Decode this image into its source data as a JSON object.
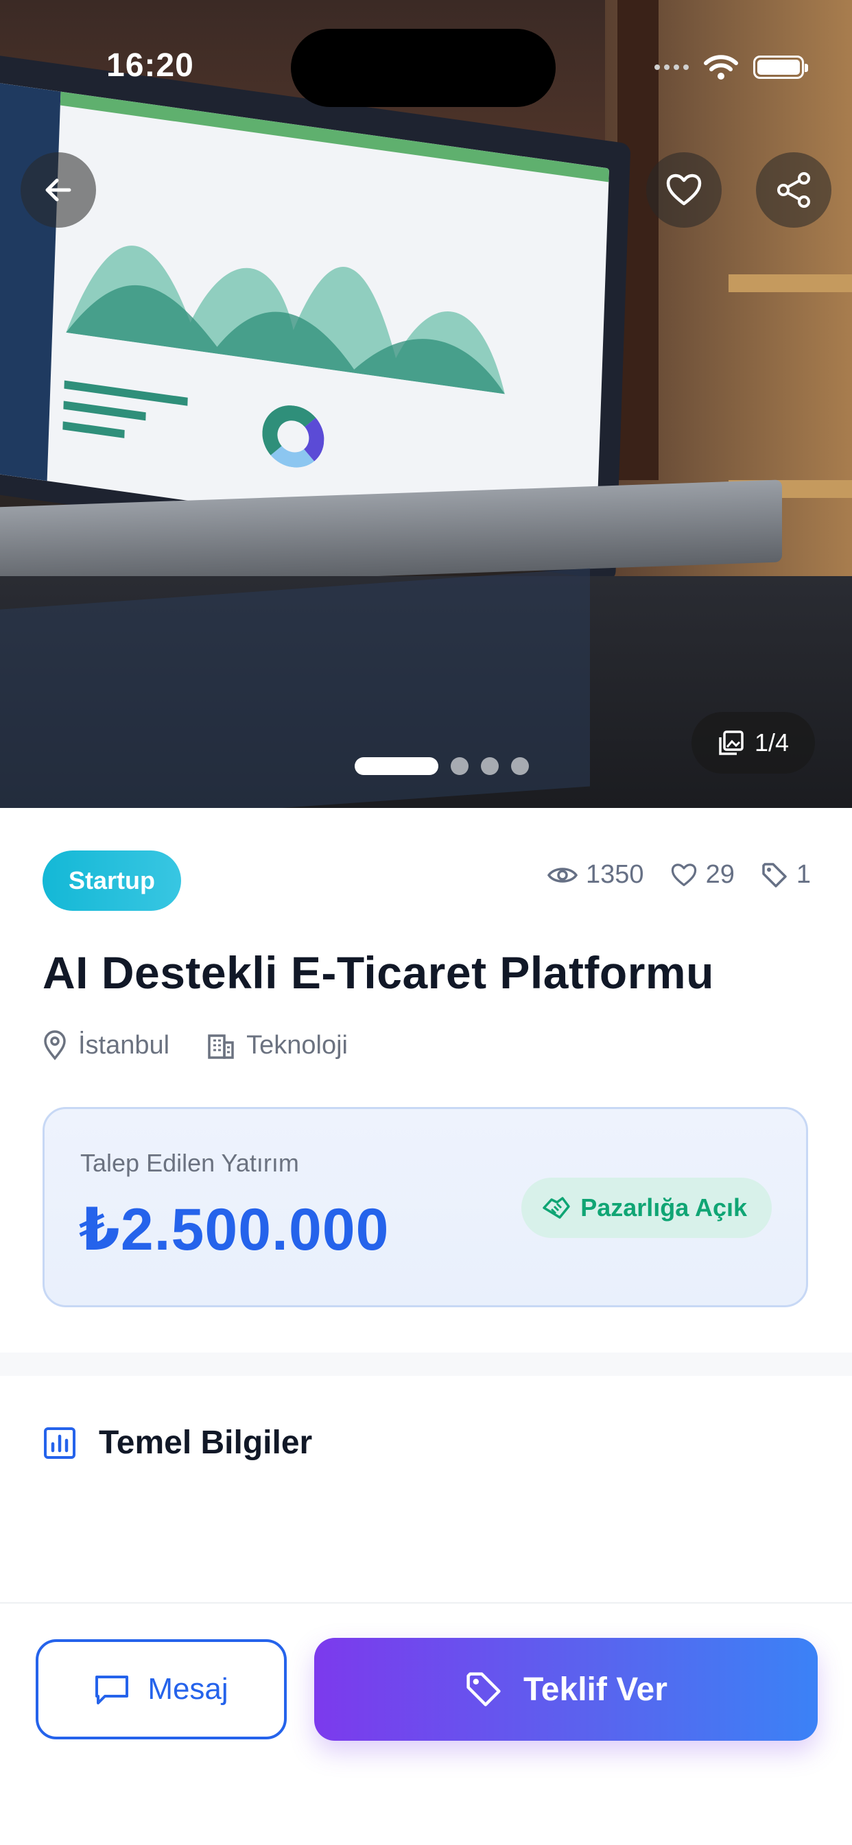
{
  "status_bar": {
    "time": "16:20"
  },
  "hero": {
    "image_counter": "1/4",
    "page_index": 1,
    "page_count": 4
  },
  "listing": {
    "category_badge": "Startup",
    "stats": {
      "views": "1350",
      "likes": "29",
      "offers": "1"
    },
    "title": "AI Destekli E-Ticaret Platformu",
    "location": "İstanbul",
    "sector": "Teknoloji"
  },
  "investment": {
    "label": "Talep Edilen Yatırım",
    "amount": "₺2.500.000",
    "negotiable_label": "Pazarlığa Açık"
  },
  "sections": {
    "basic_info_title": "Temel Bilgiler"
  },
  "actions": {
    "message_label": "Mesaj",
    "offer_label": "Teklif Ver"
  },
  "colors": {
    "primary": "#2563eb",
    "badge": "#14b8d6",
    "negotiable": "#10a574",
    "offer_gradient_start": "#7c3aed",
    "offer_gradient_end": "#3b82f6"
  },
  "icons": [
    "back-arrow-icon",
    "heart-icon",
    "share-icon",
    "gallery-icon",
    "eye-icon",
    "heart-outline-icon",
    "tag-icon",
    "location-pin-icon",
    "building-icon",
    "handshake-icon",
    "bar-chart-icon",
    "chat-icon"
  ]
}
